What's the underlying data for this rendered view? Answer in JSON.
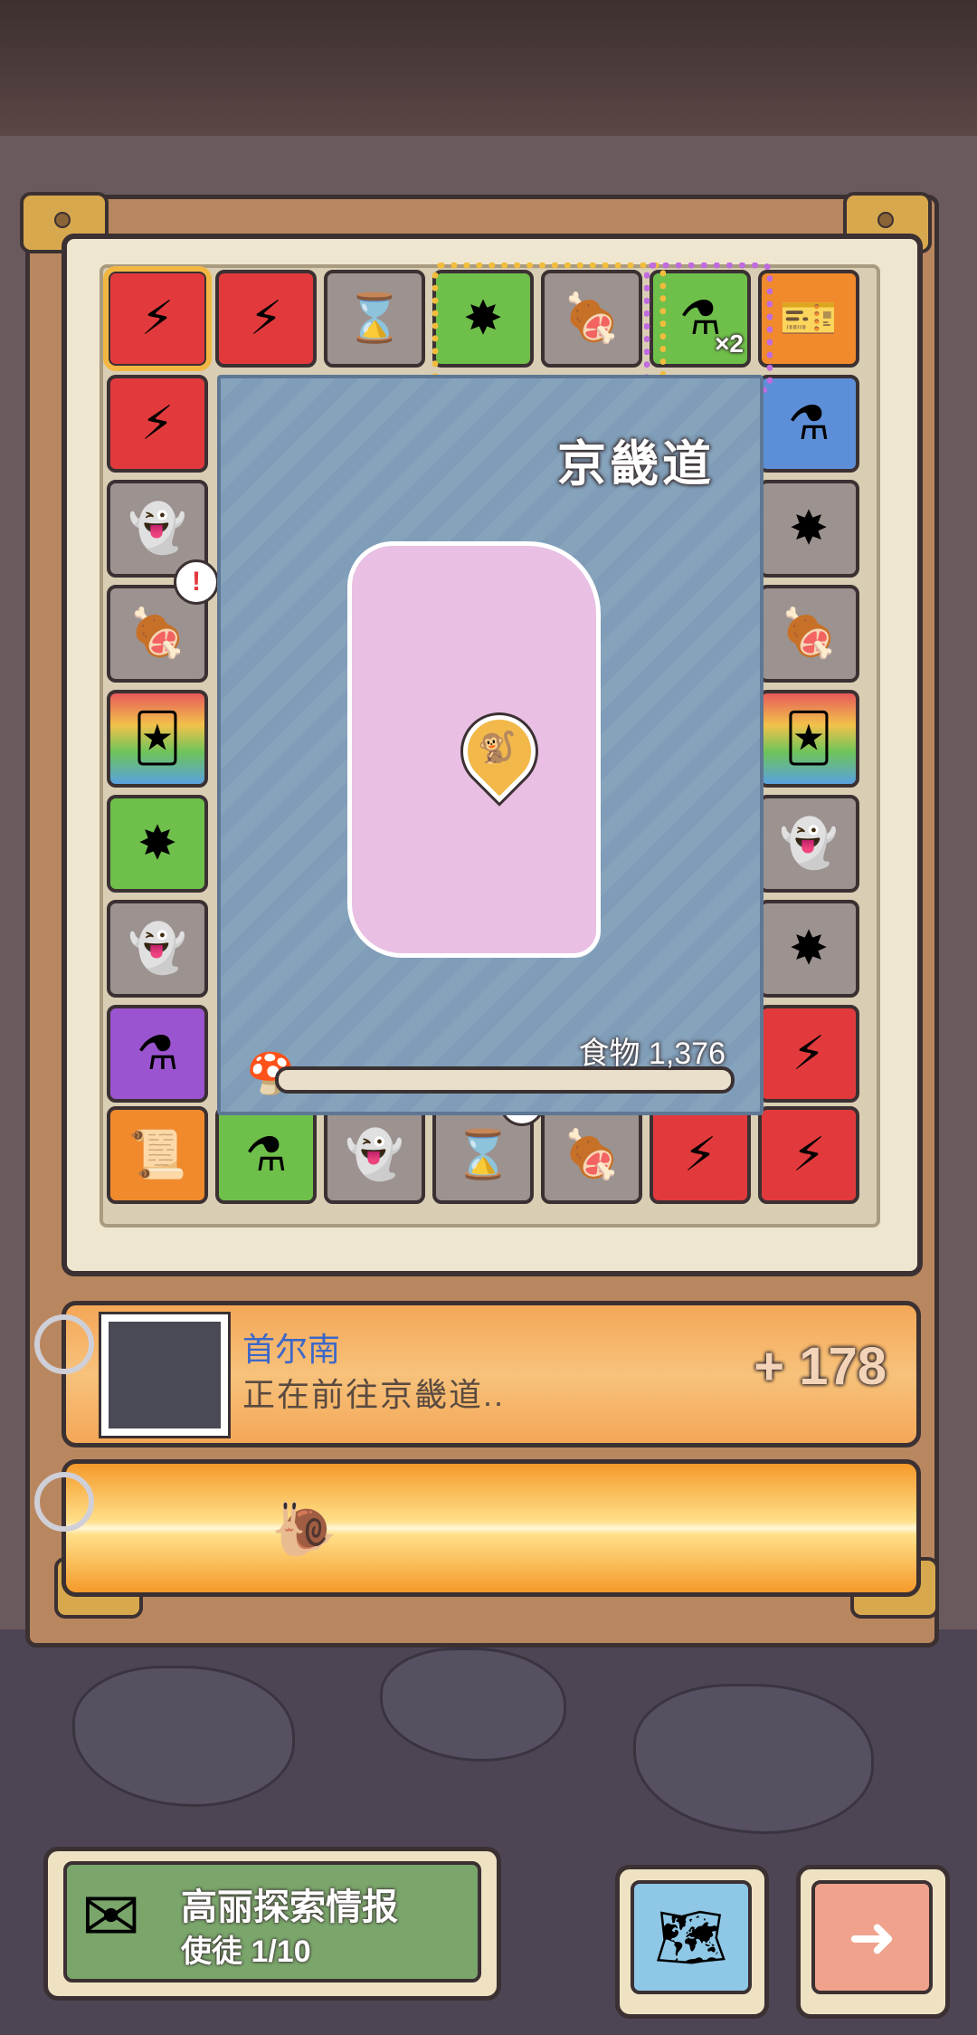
{
  "board": {
    "tiles_top": [
      {
        "icon": "⚡",
        "color": "red",
        "current": true
      },
      {
        "icon": "⚡",
        "color": "red"
      },
      {
        "icon": "⌛",
        "color": "gray"
      },
      {
        "icon": "✸",
        "color": "green"
      },
      {
        "icon": "🍖",
        "color": "gray"
      },
      {
        "icon": "⚗",
        "color": "green",
        "multiplier": "×2"
      },
      {
        "icon": "🎫",
        "color": "orange"
      }
    ],
    "tiles_left": [
      {
        "icon": "⚡",
        "color": "red"
      },
      {
        "icon": "👻",
        "color": "gray"
      },
      {
        "icon": "🍖",
        "color": "gray",
        "alert": "!"
      },
      {
        "icon": "🃏",
        "color": "rainbow"
      },
      {
        "icon": "✸",
        "color": "green"
      },
      {
        "icon": "👻",
        "color": "gray"
      },
      {
        "icon": "⚗",
        "color": "purple"
      }
    ],
    "tiles_right": [
      {
        "icon": "⚗",
        "color": "blue"
      },
      {
        "icon": "✸",
        "color": "gray"
      },
      {
        "icon": "🍖",
        "color": "gray"
      },
      {
        "icon": "🃏",
        "color": "rainbow"
      },
      {
        "icon": "👻",
        "color": "gray"
      },
      {
        "icon": "✸",
        "color": "gray"
      },
      {
        "icon": "⚡",
        "color": "red"
      }
    ],
    "tiles_bottom": [
      {
        "icon": "📜",
        "color": "orange"
      },
      {
        "icon": "⚗",
        "color": "green"
      },
      {
        "icon": "👻",
        "color": "gray"
      },
      {
        "icon": "⌛",
        "color": "gray",
        "alert": "!"
      },
      {
        "icon": "🍖",
        "color": "gray"
      },
      {
        "icon": "⚡",
        "color": "red"
      },
      {
        "icon": "⚡",
        "color": "red"
      }
    ]
  },
  "map": {
    "region": "京畿道",
    "food_label": "食物",
    "food_value": "1,376",
    "food_progress": 0.0
  },
  "card": {
    "name": "首尔南",
    "status": "正在前往京畿道..",
    "gain": "+ 178"
  },
  "bottom": {
    "info_title": "高丽探索情报",
    "info_sub": "使徒  1/10"
  },
  "colors": {
    "red": "#e23a3c",
    "gray": "#9c9290",
    "green": "#6fbf4b",
    "orange": "#f08a2d",
    "blue": "#5d8fd8",
    "purple": "#9b54cf",
    "frame": "#b9875f",
    "accent": "#f2b84a"
  }
}
